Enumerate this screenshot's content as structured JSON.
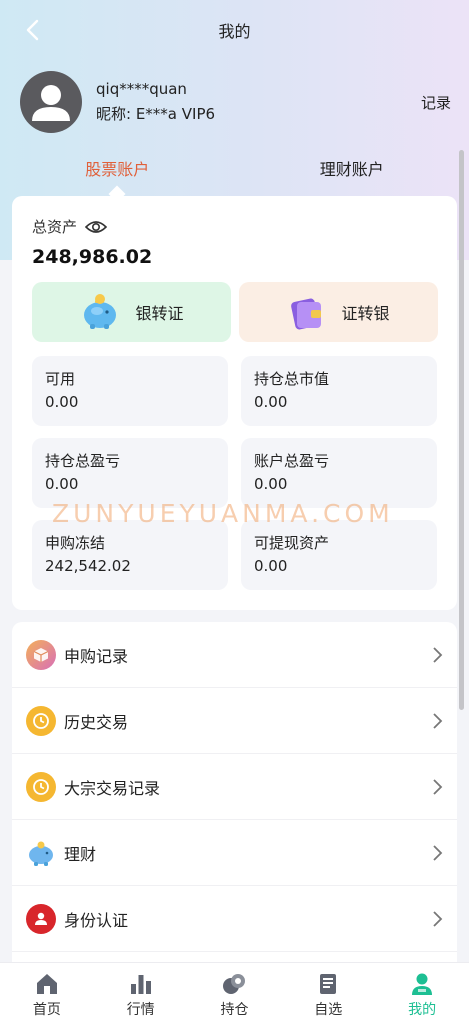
{
  "header": {
    "title": "我的",
    "records": "记录"
  },
  "user": {
    "username": "qiq****quan",
    "nickname": "昵称: E***a VIP6"
  },
  "account_tabs": [
    {
      "label": "股票账户",
      "active": true
    },
    {
      "label": "理财账户",
      "active": false
    }
  ],
  "assets": {
    "total_label": "总资产",
    "total_value": "248,986.02",
    "bank_to_securities": "银转证",
    "securities_to_bank": "证转银",
    "stats": [
      {
        "label": "可用",
        "value": "0.00"
      },
      {
        "label": "持仓总市值",
        "value": "0.00"
      },
      {
        "label": "持仓总盈亏",
        "value": "0.00"
      },
      {
        "label": "账户总盈亏",
        "value": "0.00"
      },
      {
        "label": "申购冻结",
        "value": "242,542.02"
      },
      {
        "label": "可提现资产",
        "value": "0.00"
      }
    ]
  },
  "watermark": "ZUNYUEYUANMA.COM",
  "menu": [
    {
      "label": "申购记录",
      "icon": "box-icon"
    },
    {
      "label": "历史交易",
      "icon": "clock-icon"
    },
    {
      "label": "大宗交易记录",
      "icon": "clock-icon"
    },
    {
      "label": "理财",
      "icon": "piggy-bank-icon"
    },
    {
      "label": "身份认证",
      "icon": "id-user-icon"
    }
  ],
  "tabbar": [
    {
      "label": "首页",
      "icon": "home-icon",
      "active": false
    },
    {
      "label": "行情",
      "icon": "bar-chart-icon",
      "active": false
    },
    {
      "label": "持仓",
      "icon": "coins-icon",
      "active": false
    },
    {
      "label": "自选",
      "icon": "document-icon",
      "active": false
    },
    {
      "label": "我的",
      "icon": "user-icon",
      "active": true
    }
  ],
  "colors": {
    "accent": "#e0603a",
    "active_tab": "#1dbf93"
  }
}
